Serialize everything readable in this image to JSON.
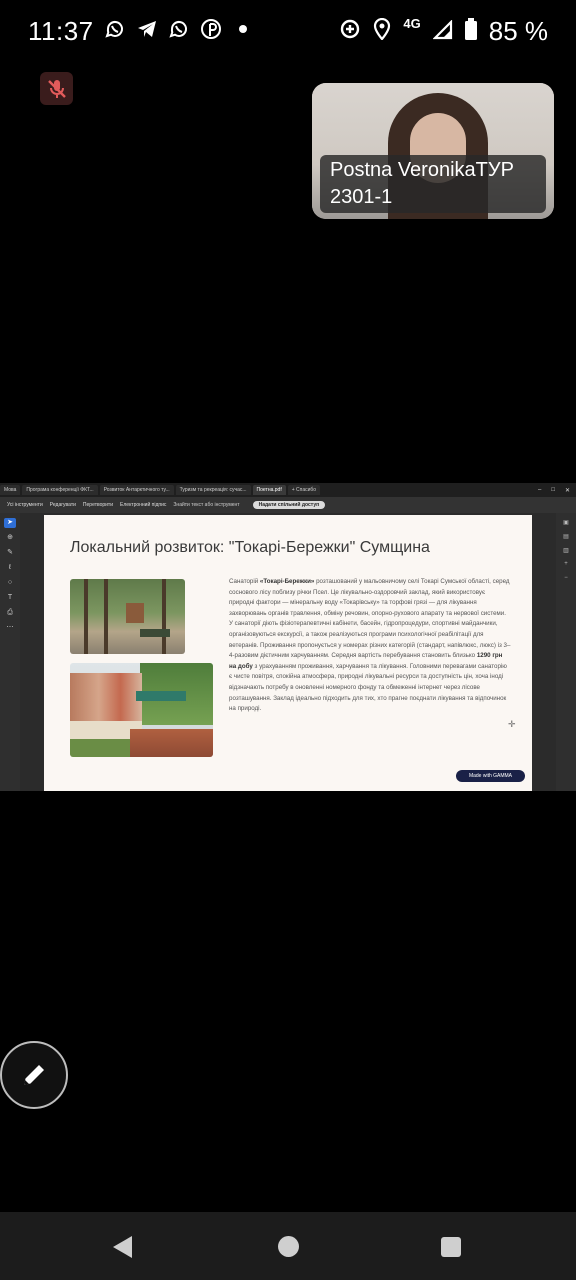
{
  "status_bar": {
    "time": "11:37",
    "network": "4G",
    "battery": "85 %",
    "app_icons": [
      "viber-icon",
      "telegram-icon",
      "viber-icon",
      "pinterest-icon",
      "dot-icon"
    ],
    "system_icons": [
      "data-saver-icon",
      "location-icon",
      "signal-icon",
      "battery-icon"
    ]
  },
  "meeting": {
    "participant_name": "Postna VeronikaТУР 2301-1"
  },
  "browser": {
    "tabs": [
      "Мова",
      "Програма конференції ФКТ...",
      "Розвиток Антарктичного ту...",
      "Туризм та рекреація: сучас...",
      "Поетна.pdf",
      "+ Спасибо"
    ],
    "active_tab": "Поетна.pdf"
  },
  "pdf_toolbar": {
    "items": [
      "Усі інструменти",
      "Редагувати",
      "Перетворити",
      "Електронний підпис"
    ],
    "search": "Знайти текст або інструмент",
    "share": "Надати спільний доступ"
  },
  "slide": {
    "title": "Локальний розвиток: \"Токарі-Бережки\" Сумщина",
    "text_a": "Санаторій ",
    "text_b": "«Токарі-Бережки»",
    "text_c": " розташований у мальовничому селі Токарі Сумської області, серед соснового лісу поблизу річки Псел. Це лікувально-оздоровчий заклад, який використовує природні фактори — мінеральну воду «Токарівську» та торфові грязі — для лікування захворювань органів травлення, обміну речовин, опорно-рухового апарату та нервової системи. У санаторії діють фізіотерапевтичні кабінети, басейн, гідропроцедури, спортивні майданчики, організовуються екскурсії, а також реалізуються програми психологічної реабілітації для ветеранів. Проживання пропонується у номерах різних категорій (стандарт, напівлюкс, люкс) із 3–4-разовим дієтичним харчуванням. Середня вартість перебування становить близько ",
    "text_d": "1290 грн на добу",
    "text_e": " з урахуванням проживання, харчування та лікування. Головними перевагами санаторію є чисте повітря, спокійна атмосфера, природні лікувальні ресурси та доступність цін, хоча іноді відзначають потребу в оновленні номерного фонду та обмеженні інтернет через лісове розташування. Заклад ідеально підходить для тих, хто прагне поєднати лікування та відпочинок на природі.",
    "badge": "Made with GAMMA"
  }
}
